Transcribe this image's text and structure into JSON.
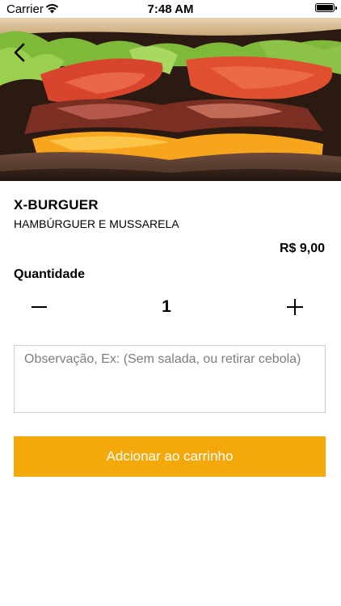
{
  "status_bar": {
    "carrier": "Carrier",
    "time": "7:48 AM"
  },
  "product": {
    "name": "X-BURGUER",
    "description": "HAMBÚRGUER E MUSSARELA",
    "price": "R$ 9,00",
    "image_icon": "burger-photo"
  },
  "quantity": {
    "label": "Quantidade",
    "value": "1"
  },
  "notes": {
    "placeholder": "Observação, Ex: (Sem salada, ou retirar cebola)",
    "value": ""
  },
  "actions": {
    "add_to_cart": "Adcionar ao carrinho"
  },
  "colors": {
    "accent": "#f5a809",
    "border": "#cfcfcf"
  },
  "icons": {
    "back": "chevron-left-icon",
    "minus": "minus-icon",
    "plus": "plus-icon",
    "wifi": "wifi-icon",
    "battery": "battery-icon"
  }
}
